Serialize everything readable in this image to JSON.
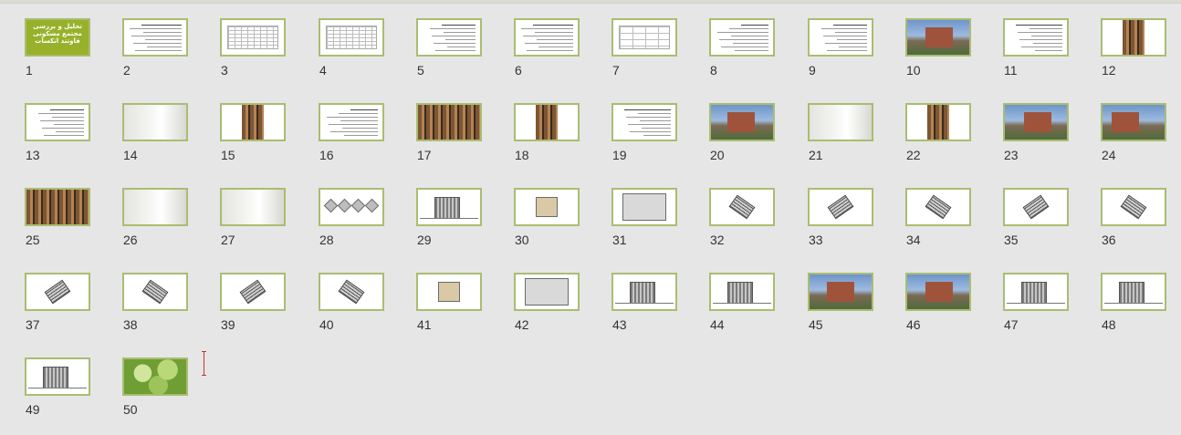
{
  "slide_sorter": {
    "accent_border": "#a9bd72",
    "title_slide_text": "تحلیل و بررسی مجتمع مسکونی فاوتند اتکسات",
    "slides": [
      {
        "number": "1",
        "kind": "title"
      },
      {
        "number": "2",
        "kind": "text"
      },
      {
        "number": "3",
        "kind": "table"
      },
      {
        "number": "4",
        "kind": "table"
      },
      {
        "number": "5",
        "kind": "text"
      },
      {
        "number": "6",
        "kind": "text"
      },
      {
        "number": "7",
        "kind": "sparse-table"
      },
      {
        "number": "8",
        "kind": "text"
      },
      {
        "number": "9",
        "kind": "text"
      },
      {
        "number": "10",
        "kind": "photo-exterior"
      },
      {
        "number": "11",
        "kind": "text"
      },
      {
        "number": "12",
        "kind": "photo-facade"
      },
      {
        "number": "13",
        "kind": "text"
      },
      {
        "number": "14",
        "kind": "photo-interior"
      },
      {
        "number": "15",
        "kind": "photo-facade"
      },
      {
        "number": "16",
        "kind": "text"
      },
      {
        "number": "17",
        "kind": "photo-wood"
      },
      {
        "number": "18",
        "kind": "photo-facade"
      },
      {
        "number": "19",
        "kind": "text"
      },
      {
        "number": "20",
        "kind": "photo-exterior"
      },
      {
        "number": "21",
        "kind": "photo-interior"
      },
      {
        "number": "22",
        "kind": "photo-facade"
      },
      {
        "number": "23",
        "kind": "photo-exterior"
      },
      {
        "number": "24",
        "kind": "photo-exterior"
      },
      {
        "number": "25",
        "kind": "photo-wood"
      },
      {
        "number": "26",
        "kind": "photo-interior"
      },
      {
        "number": "27",
        "kind": "photo-interior"
      },
      {
        "number": "28",
        "kind": "diagram"
      },
      {
        "number": "29",
        "kind": "elevation"
      },
      {
        "number": "30",
        "kind": "plan"
      },
      {
        "number": "31",
        "kind": "plan-gray"
      },
      {
        "number": "32",
        "kind": "plan-rotated"
      },
      {
        "number": "33",
        "kind": "plan-rotated"
      },
      {
        "number": "34",
        "kind": "plan-rotated"
      },
      {
        "number": "35",
        "kind": "plan-rotated"
      },
      {
        "number": "36",
        "kind": "plan-rotated"
      },
      {
        "number": "37",
        "kind": "plan-rotated"
      },
      {
        "number": "38",
        "kind": "plan-rotated"
      },
      {
        "number": "39",
        "kind": "plan-rotated"
      },
      {
        "number": "40",
        "kind": "plan-rotated"
      },
      {
        "number": "41",
        "kind": "plan"
      },
      {
        "number": "42",
        "kind": "plan-gray"
      },
      {
        "number": "43",
        "kind": "elevation"
      },
      {
        "number": "44",
        "kind": "elevation"
      },
      {
        "number": "45",
        "kind": "photo-exterior"
      },
      {
        "number": "46",
        "kind": "photo-exterior"
      },
      {
        "number": "47",
        "kind": "elevation"
      },
      {
        "number": "48",
        "kind": "elevation"
      },
      {
        "number": "49",
        "kind": "elevation"
      },
      {
        "number": "50",
        "kind": "green"
      }
    ]
  }
}
